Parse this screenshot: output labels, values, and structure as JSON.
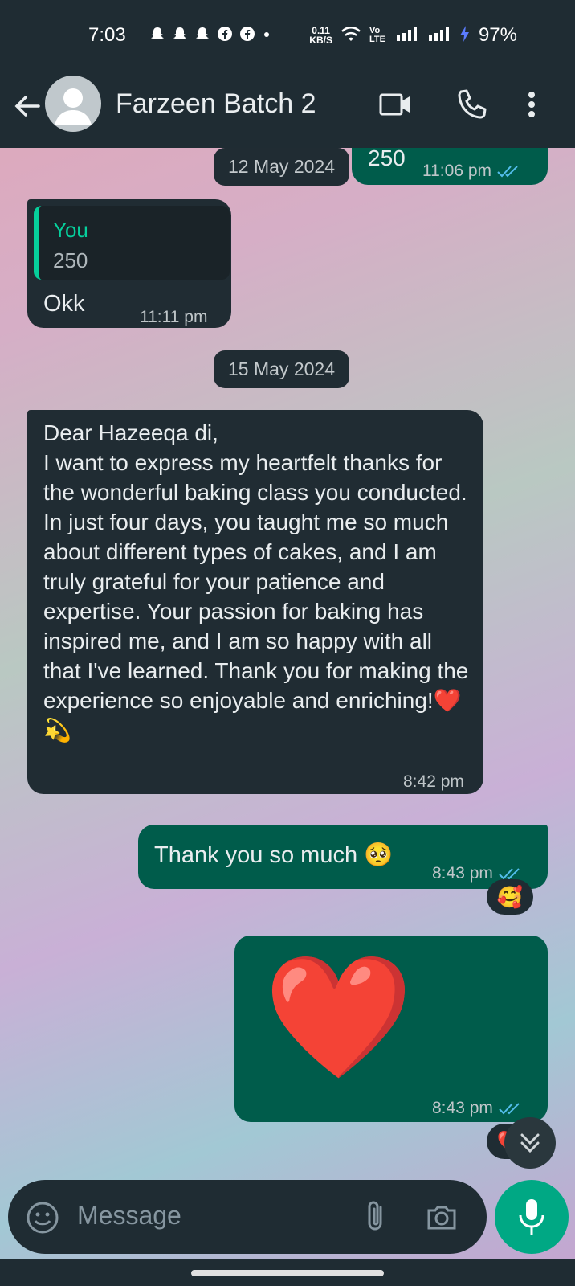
{
  "status_bar": {
    "time": "7:03",
    "net_speed_value": "0.11",
    "net_speed_unit": "KB/S",
    "volte_label": "Vo LTE",
    "battery": "97%"
  },
  "app_bar": {
    "title": "Farzeen Batch 2"
  },
  "messages": {
    "first_out_text": "250",
    "first_out_time": "11:06 pm",
    "date1": "12 May 2024",
    "quote_author": "You",
    "quote_text": "250",
    "reply_text": "Okk",
    "reply_time": "11:11 pm",
    "date2": "15 May 2024",
    "long_text": "Dear Hazeeqa di,\nI want to express my heartfelt thanks for the wonderful baking class you conducted. In just four days, you taught me so much about different types of cakes, and I am truly grateful for your patience and expertise. Your passion for baking has inspired me, and I am so happy with all that I've learned. Thank you for making the experience so enjoyable and enriching!❤️💫",
    "long_time": "8:42 pm",
    "thanks_text": "Thank you so much 🥺",
    "thanks_time": "8:43 pm",
    "thanks_reaction": "🥰",
    "heart_emoji": "❤️",
    "heart_time": "8:43 pm",
    "heart_reaction": "❤️"
  },
  "composer": {
    "placeholder": "Message"
  },
  "colors": {
    "bar": "#1f2c33",
    "incoming": "#202c33",
    "outgoing": "#005c4b",
    "accent": "#00a884",
    "tick_blue": "#53bdeb"
  },
  "icons": [
    "arrow-back-icon",
    "avatar-placeholder-icon",
    "video-call-icon",
    "phone-icon",
    "more-vert-icon",
    "emoji-icon",
    "attach-icon",
    "camera-icon",
    "mic-icon",
    "double-chevron-down-icon",
    "double-tick-icon"
  ]
}
